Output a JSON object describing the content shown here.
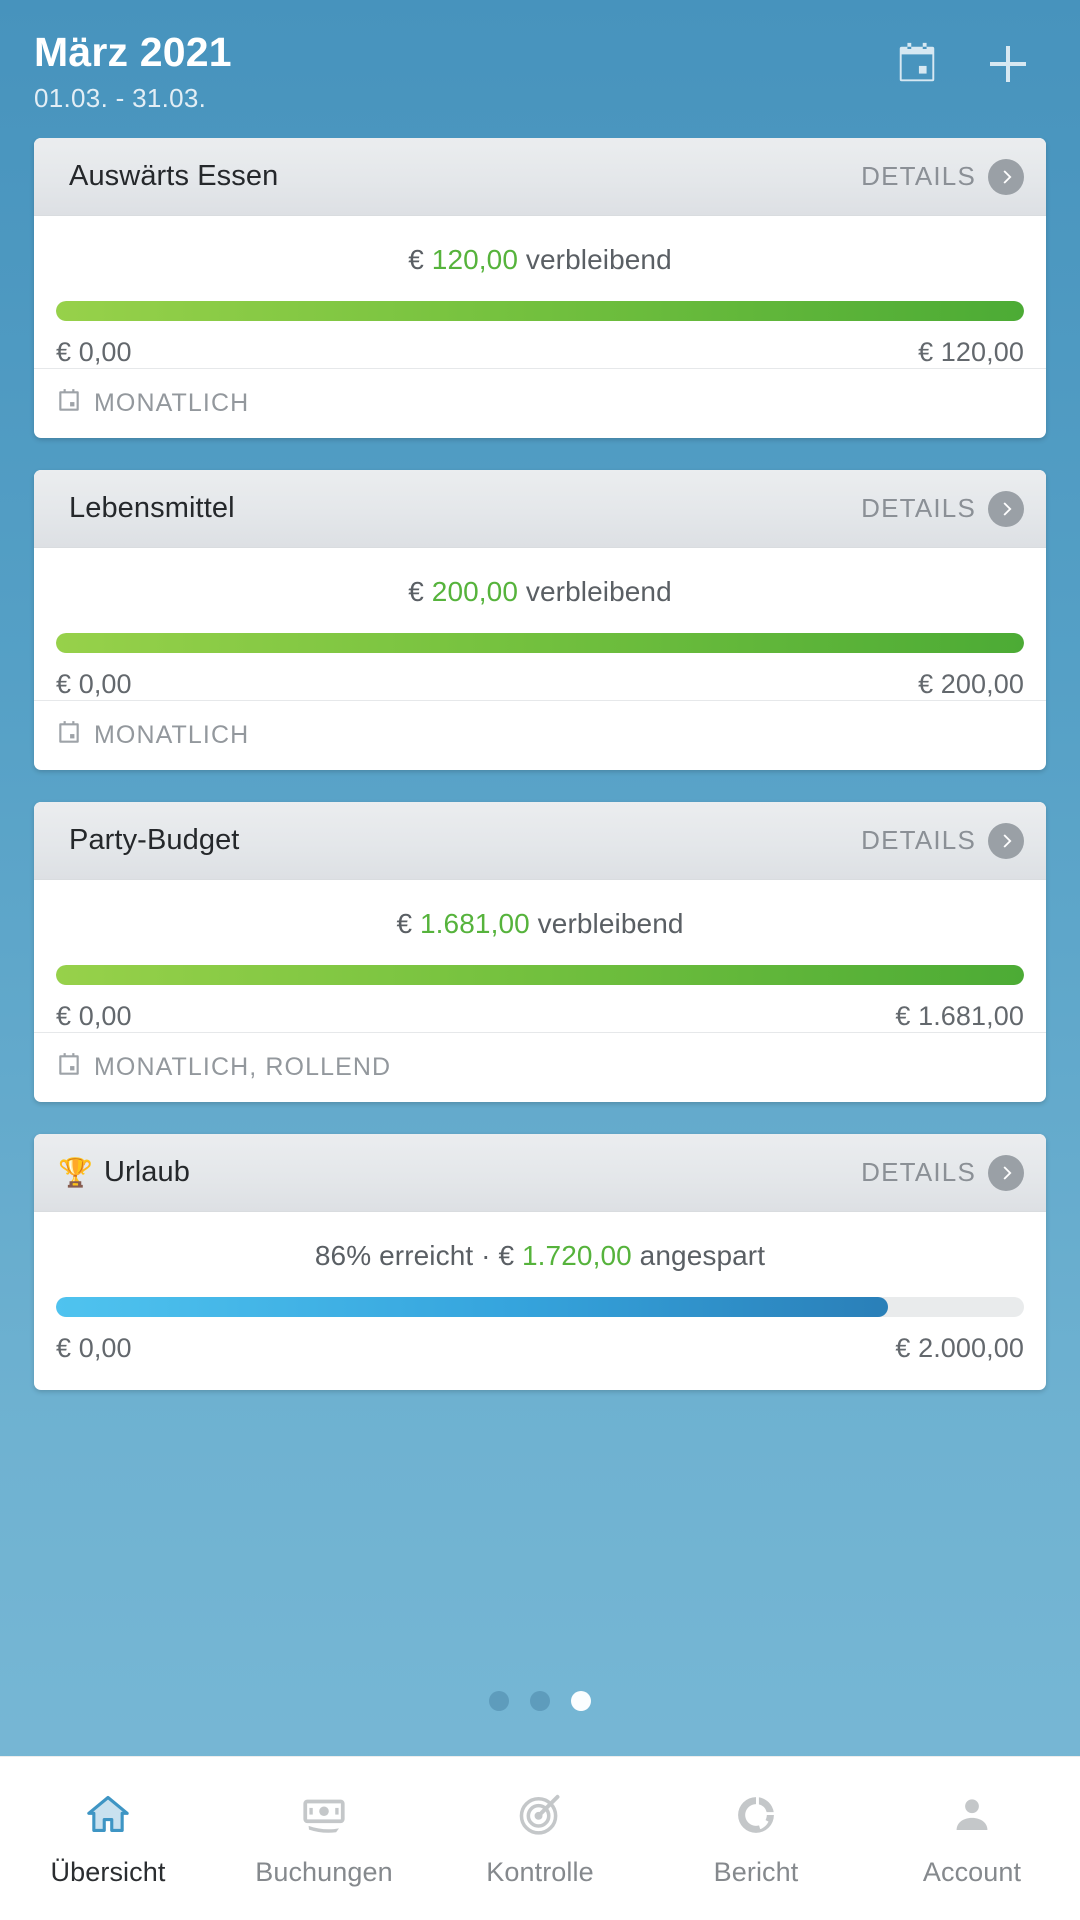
{
  "header": {
    "title": "März 2021",
    "date_range": "01.03. - 31.03.",
    "calendar_icon": "calendar-icon",
    "add_icon": "plus-icon"
  },
  "details_label": "DETAILS",
  "budgets": [
    {
      "name": "Auswärts Essen",
      "emoji": "",
      "summary_prefix": "€ ",
      "summary_amount": "120,00",
      "summary_suffix": " verbleibend",
      "min": "€ 0,00",
      "max": "€ 120,00",
      "fill_percent": 100,
      "bar_style": "green",
      "recurrence": "MONATLICH",
      "has_footer": true
    },
    {
      "name": "Lebensmittel",
      "emoji": "",
      "summary_prefix": "€ ",
      "summary_amount": "200,00",
      "summary_suffix": " verbleibend",
      "min": "€ 0,00",
      "max": "€ 200,00",
      "fill_percent": 100,
      "bar_style": "green",
      "recurrence": "MONATLICH",
      "has_footer": true
    },
    {
      "name": "Party-Budget",
      "emoji": "",
      "summary_prefix": "€ ",
      "summary_amount": "1.681,00",
      "summary_suffix": " verbleibend",
      "min": "€ 0,00",
      "max": "€ 1.681,00",
      "fill_percent": 100,
      "bar_style": "green",
      "recurrence": "MONATLICH, ROLLEND",
      "has_footer": true
    },
    {
      "name": "Urlaub",
      "emoji": "🏆",
      "summary_prefix": "86% erreicht · € ",
      "summary_amount": "1.720,00",
      "summary_suffix": " angespart",
      "min": "€ 0,00",
      "max": "€ 2.000,00",
      "fill_percent": 86,
      "bar_style": "blue",
      "recurrence": "",
      "has_footer": false
    }
  ],
  "pagination": {
    "total": 3,
    "active_index": 2
  },
  "bottom_nav": [
    {
      "label": "Übersicht",
      "icon": "home-icon",
      "active": true
    },
    {
      "label": "Buchungen",
      "icon": "banknote-icon",
      "active": false
    },
    {
      "label": "Kontrolle",
      "icon": "target-icon",
      "active": false
    },
    {
      "label": "Bericht",
      "icon": "donut-chart-icon",
      "active": false
    },
    {
      "label": "Account",
      "icon": "person-icon",
      "active": false
    }
  ],
  "colors": {
    "background_top": "#4793bd",
    "background_bottom": "#7ab9d6",
    "accent_green": "#56b33c",
    "accent_blue": "#35a4dd",
    "card_header": "#e4e7ea"
  }
}
